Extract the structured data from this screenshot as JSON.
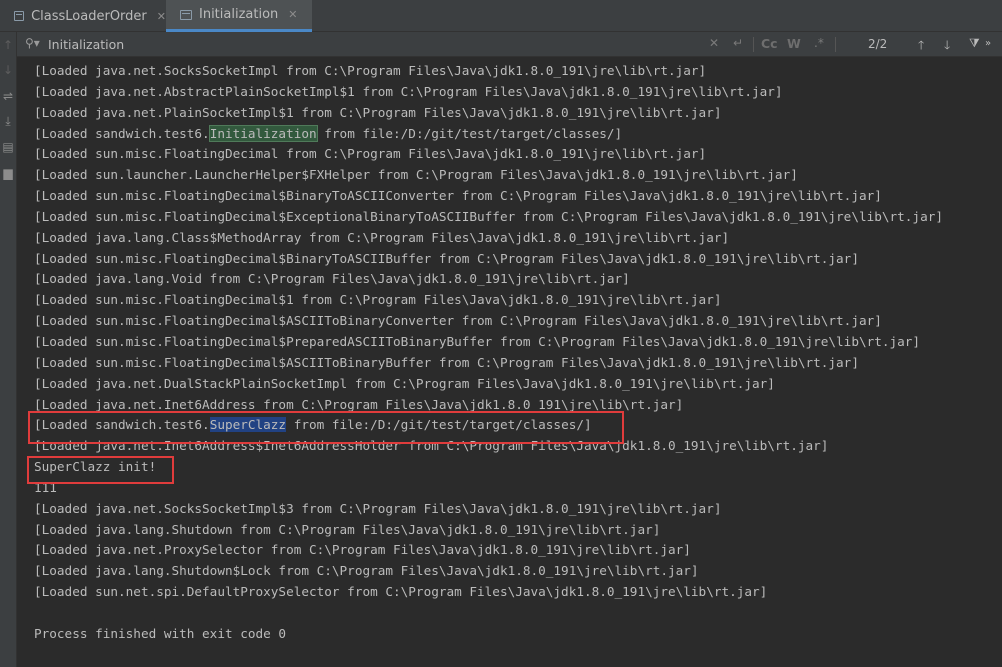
{
  "tabs": [
    {
      "label": "ClassLoaderOrder",
      "active": false
    },
    {
      "label": "Initialization",
      "active": true
    }
  ],
  "search": {
    "value": "Initialization",
    "match_case_label": "Cc",
    "whole_words_label": "W",
    "match_count": "2/2"
  },
  "console": {
    "lines": [
      "[Loaded java.net.SocksSocketImpl from C:\\Program Files\\Java\\jdk1.8.0_191\\jre\\lib\\rt.jar]",
      "[Loaded java.net.AbstractPlainSocketImpl$1 from C:\\Program Files\\Java\\jdk1.8.0_191\\jre\\lib\\rt.jar]",
      "[Loaded java.net.PlainSocketImpl$1 from C:\\Program Files\\Java\\jdk1.8.0_191\\jre\\lib\\rt.jar]",
      "[Loaded sandwich.test6.Initialization from file:/D:/git/test/target/classes/]",
      "[Loaded sun.misc.FloatingDecimal from C:\\Program Files\\Java\\jdk1.8.0_191\\jre\\lib\\rt.jar]",
      "[Loaded sun.launcher.LauncherHelper$FXHelper from C:\\Program Files\\Java\\jdk1.8.0_191\\jre\\lib\\rt.jar]",
      "[Loaded sun.misc.FloatingDecimal$BinaryToASCIIConverter from C:\\Program Files\\Java\\jdk1.8.0_191\\jre\\lib\\rt.jar]",
      "[Loaded sun.misc.FloatingDecimal$ExceptionalBinaryToASCIIBuffer from C:\\Program Files\\Java\\jdk1.8.0_191\\jre\\lib\\rt.jar]",
      "[Loaded java.lang.Class$MethodArray from C:\\Program Files\\Java\\jdk1.8.0_191\\jre\\lib\\rt.jar]",
      "[Loaded sun.misc.FloatingDecimal$BinaryToASCIIBuffer from C:\\Program Files\\Java\\jdk1.8.0_191\\jre\\lib\\rt.jar]",
      "[Loaded java.lang.Void from C:\\Program Files\\Java\\jdk1.8.0_191\\jre\\lib\\rt.jar]",
      "[Loaded sun.misc.FloatingDecimal$1 from C:\\Program Files\\Java\\jdk1.8.0_191\\jre\\lib\\rt.jar]",
      "[Loaded sun.misc.FloatingDecimal$ASCIIToBinaryConverter from C:\\Program Files\\Java\\jdk1.8.0_191\\jre\\lib\\rt.jar]",
      "[Loaded sun.misc.FloatingDecimal$PreparedASCIIToBinaryBuffer from C:\\Program Files\\Java\\jdk1.8.0_191\\jre\\lib\\rt.jar]",
      "[Loaded sun.misc.FloatingDecimal$ASCIIToBinaryBuffer from C:\\Program Files\\Java\\jdk1.8.0_191\\jre\\lib\\rt.jar]",
      "[Loaded java.net.DualStackPlainSocketImpl from C:\\Program Files\\Java\\jdk1.8.0_191\\jre\\lib\\rt.jar]",
      "[Loaded java.net.Inet6Address from C:\\Program Files\\Java\\jdk1.8.0_191\\jre\\lib\\rt.jar]",
      "[Loaded sandwich.test6.SuperClazz from file:/D:/git/test/target/classes/]",
      "[Loaded java.net.Inet6Address$Inet6AddressHolder from C:\\Program Files\\Java\\jdk1.8.0_191\\jre\\lib\\rt.jar]",
      "SuperClazz init!",
      "111",
      "[Loaded java.net.SocksSocketImpl$3 from C:\\Program Files\\Java\\jdk1.8.0_191\\jre\\lib\\rt.jar]",
      "[Loaded java.lang.Shutdown from C:\\Program Files\\Java\\jdk1.8.0_191\\jre\\lib\\rt.jar]",
      "[Loaded java.net.ProxySelector from C:\\Program Files\\Java\\jdk1.8.0_191\\jre\\lib\\rt.jar]",
      "[Loaded java.lang.Shutdown$Lock from C:\\Program Files\\Java\\jdk1.8.0_191\\jre\\lib\\rt.jar]",
      "[Loaded sun.net.spi.DefaultProxySelector from C:\\Program Files\\Java\\jdk1.8.0_191\\jre\\lib\\rt.jar]",
      "",
      "Process finished with exit code 0"
    ],
    "highlights": [
      {
        "line": 3,
        "text": "Initialization",
        "kind": "search-match"
      },
      {
        "line": 17,
        "text": "SuperClazz",
        "kind": "selection"
      }
    ]
  },
  "colors": {
    "background": "#2b2b2b",
    "text": "#bbbbbb",
    "search_match": "#32593d",
    "selection": "#214283",
    "annotation_box": "#e03c3c"
  }
}
